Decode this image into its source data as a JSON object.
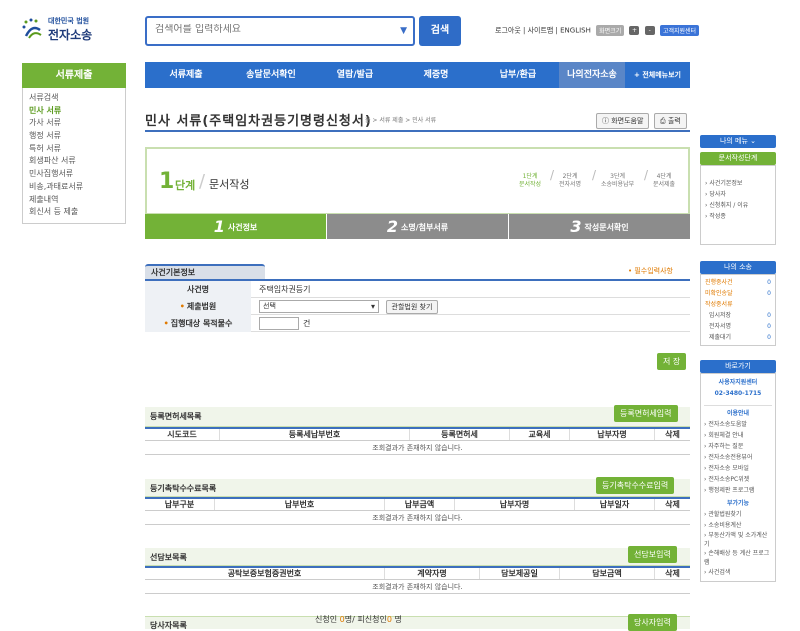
{
  "header": {
    "logo_small": "대한민국 법원",
    "logo_big": "전자소송",
    "search_placeholder": "검색어를 입력하세요",
    "search_button": "검색",
    "top_links": "로그아웃 | 사이트맵 | ENGLISH",
    "zoom_label": "화면크기",
    "zoom_plus": "+",
    "zoom_minus": "-",
    "support_label": "고객지원센터"
  },
  "nav": {
    "items": [
      "서류제출",
      "송달문서확인",
      "열람/발급",
      "제증명",
      "납부/환급",
      "나의전자소송",
      "+ 전체메뉴보기"
    ]
  },
  "left_menu": {
    "title": "서류제출",
    "items": [
      "서류검색",
      "민사 서류",
      "가사 서류",
      "행정 서류",
      "특허 서류",
      "회생파산 서류",
      "민사집행서류",
      "비송,과태료서류",
      "제출내역",
      "회신서 등 제출"
    ]
  },
  "page": {
    "title": "민사 서류(주택임차권등기명령신청서)",
    "breadcrumb": "홈 > 서류 제출 > 민사 서류",
    "help_button": "화면도움말",
    "print_button": "출력"
  },
  "step": {
    "number": "1",
    "dan": "단계",
    "title": "문서작성",
    "steps": [
      {
        "line1": "1단계",
        "line2": "문서작성"
      },
      {
        "line1": "2단계",
        "line2": "전자서명"
      },
      {
        "line1": "3단계",
        "line2": "소송비용납부"
      },
      {
        "line1": "4단계",
        "line2": "문서제출"
      }
    ]
  },
  "tabs": [
    {
      "num": "1",
      "label": "사건정보"
    },
    {
      "num": "2",
      "label": "소명/첨부서류"
    },
    {
      "num": "3",
      "label": "작성문서확인"
    }
  ],
  "case_info": {
    "title": "사건기본정보",
    "required_note": "• 필수입력사항",
    "rows": {
      "case_name_label": "사건명",
      "case_name_value": "주택임차권등기",
      "court_label": "제출법원",
      "court_select": "선택",
      "court_find_button": "관할법원 찾기",
      "count_label": "집행대상 목적물수",
      "count_unit": "건"
    },
    "save_button": "저 장"
  },
  "tax_table": {
    "title": "등록면허세목록",
    "button": "등록면허세입력",
    "headers": [
      "시도코드",
      "등록세납부번호",
      "등록면허세",
      "교육세",
      "납부자명",
      "삭제"
    ],
    "empty": "조회결과가 존재하지 않습니다."
  },
  "fee_table": {
    "title": "등기촉탁수수료목록",
    "button": "등기촉탁수수료입력",
    "headers": [
      "납부구분",
      "납부번호",
      "납부금액",
      "납부자명",
      "납부일자",
      "삭제"
    ],
    "empty": "조회결과가 존재하지 않습니다."
  },
  "security_table": {
    "title": "선담보목록",
    "button": "선담보입력",
    "headers": [
      "공탁보증보험증권번호",
      "계약자명",
      "담보제공일",
      "담보금액",
      "삭제"
    ],
    "empty": "조회결과가 존재하지 않습니다."
  },
  "party_table": {
    "title": "당사자목록",
    "applicant_label": "신청인",
    "applicant_count": "0",
    "respondent_label": "피신청인",
    "respondent_count": "0",
    "unit": "명",
    "separator": "/",
    "button": "당사자입력"
  },
  "right_sidebar": {
    "my_menu": "나의 메뉴",
    "doc_step_title": "문서작성단계",
    "doc_steps": [
      "사건기본정보",
      "당사자",
      "신청취지 / 이유",
      "작성종"
    ],
    "my_case_title": "나의 소송",
    "my_case_rows": [
      {
        "label": "진행중사건",
        "value": "0"
      },
      {
        "label": "미확인송달",
        "value": "0"
      },
      {
        "label": "작성중서류",
        "value": ""
      },
      {
        "label": "임시저장",
        "value": "0"
      },
      {
        "label": "전자서명",
        "value": "0"
      },
      {
        "label": "제출대기",
        "value": "0"
      }
    ],
    "shortcut_title": "바로가기",
    "support_center": "사용자지원센터",
    "support_phone": "02-3480-1715",
    "guide_title": "이용안내",
    "guide_items": [
      "전자소송도움말",
      "회원체결 안내",
      "자주하는 질문",
      "전자소송전용뷰어",
      "전자소송 모바일",
      "전자소송PC위젯",
      "행정제판 프로그램"
    ],
    "extra_title": "부가기능",
    "extra_items": [
      "관할법원찾기",
      "소송비용계산",
      "부동산가액 및 소가계산기",
      "손해배상 등 계산 프로그램",
      "사건검색"
    ]
  },
  "colors": {
    "nav_blue": "#2b6fcb",
    "green": "#73b237",
    "tab_gray": "#8c8c8c",
    "orange": "#e07a00"
  }
}
